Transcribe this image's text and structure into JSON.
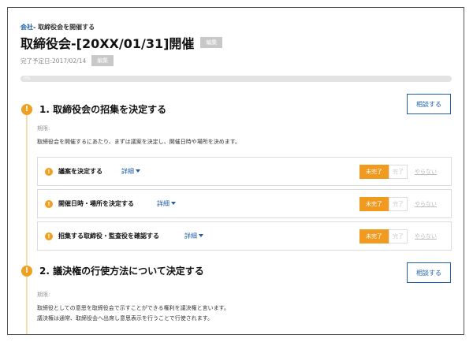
{
  "breadcrumb": {
    "parent": "会社",
    "sep": "- ",
    "current": "取締役会を開催する"
  },
  "page": {
    "title": "取締役会-[20XX/01/31]開催",
    "edit_tag": "編集",
    "due_label": "完了予定日:2017/02/14",
    "due_edit_tag": "編集",
    "progress_percent": 0,
    "progress_text": "0%"
  },
  "consult_label": "相談する",
  "status_labels": {
    "incomplete": "未完了",
    "complete": "完了",
    "skip": "やらない"
  },
  "steps": [
    {
      "title": "1. 取締役会の招集を決定する",
      "period_label": "期限:",
      "description": [
        "取締役会を開催するにあたり、まずは議案を決定し、開催日時や場所を決めます。"
      ],
      "tasks": [
        {
          "title": "議案を決定する",
          "detail": "詳細"
        },
        {
          "title": "開催日時・場所を決定する",
          "detail": "詳細"
        },
        {
          "title": "招集する取締役・監査役を確認する",
          "detail": "詳細"
        }
      ]
    },
    {
      "title": "2. 議決権の行使方法について決定する",
      "period_label": "期限:",
      "description": [
        "取締役としての意思を取締役会で示すことができる権利を議決権と言います。",
        "議決権は通常、取締役会へ出席し意思表示を行うことで行使されます。"
      ],
      "tasks": []
    }
  ],
  "icons": {
    "warning": "exclamation-icon",
    "caret": "caret-down-icon"
  },
  "colors": {
    "accent": "#1f5fa8",
    "warning": "#f0a020",
    "status_active": "#f09a20"
  }
}
